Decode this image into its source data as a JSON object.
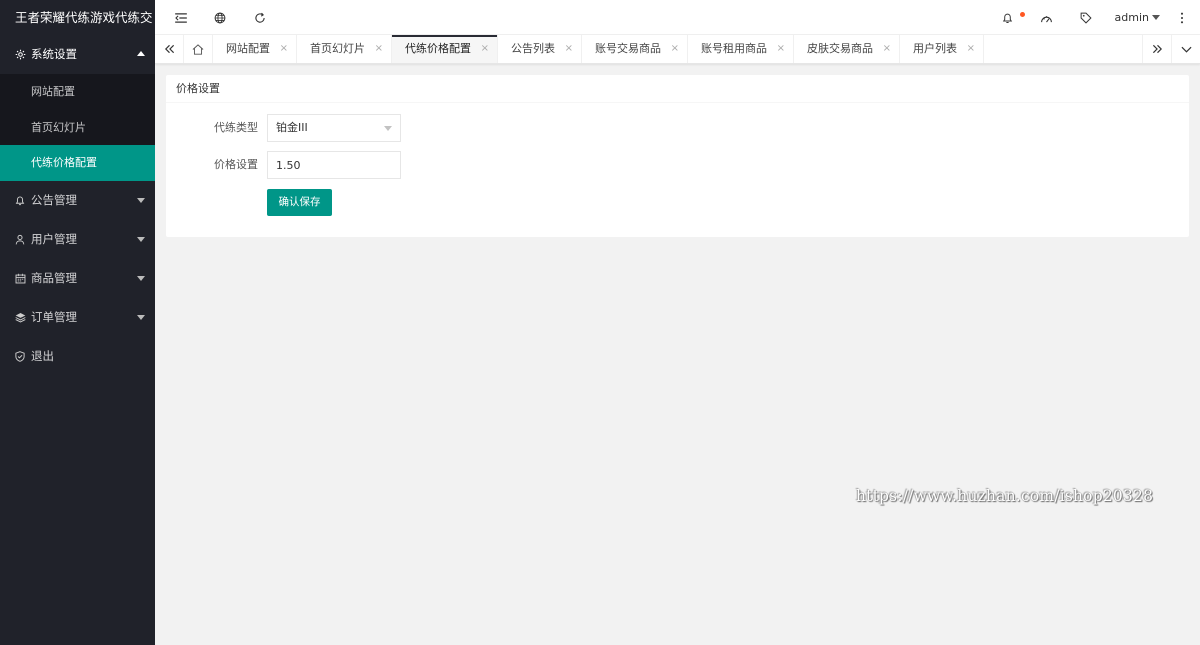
{
  "app": {
    "title": "王者荣耀代练游戏代练交"
  },
  "sidebar": {
    "menus": [
      {
        "label": "系统设置",
        "icon": "gear-icon",
        "open": true,
        "children": [
          {
            "label": "网站配置"
          },
          {
            "label": "首页幻灯片"
          },
          {
            "label": "代练价格配置",
            "active": true
          }
        ]
      },
      {
        "label": "公告管理",
        "icon": "bell-icon"
      },
      {
        "label": "用户管理",
        "icon": "user-icon"
      },
      {
        "label": "商品管理",
        "icon": "calendar-icon"
      },
      {
        "label": "订单管理",
        "icon": "layers-icon"
      },
      {
        "label": "退出",
        "icon": "shield-icon"
      }
    ]
  },
  "header": {
    "user": "admin",
    "icons": [
      "menu-collapse-icon",
      "globe-icon",
      "refresh-icon",
      "bell-icon",
      "theme-icon",
      "tag-icon",
      "more-icon"
    ],
    "notification_dot_color": "#ff5722"
  },
  "tabs": {
    "items": [
      {
        "label": "网站配置"
      },
      {
        "label": "首页幻灯片"
      },
      {
        "label": "代练价格配置",
        "active": true
      },
      {
        "label": "公告列表"
      },
      {
        "label": "账号交易商品"
      },
      {
        "label": "账号租用商品"
      },
      {
        "label": "皮肤交易商品"
      },
      {
        "label": "用户列表"
      }
    ],
    "close_glyph": "×"
  },
  "form": {
    "card_title": "价格设置",
    "type_label": "代练类型",
    "type_value": "铂金III",
    "price_label": "价格设置",
    "price_value": "1.50",
    "save_label": "确认保存"
  },
  "watermark": "https://www.huzhan.com/ishop20328",
  "colors": {
    "accent": "#009688",
    "sidebar_bg": "#20222a",
    "page_bg": "#f2f2f2"
  }
}
